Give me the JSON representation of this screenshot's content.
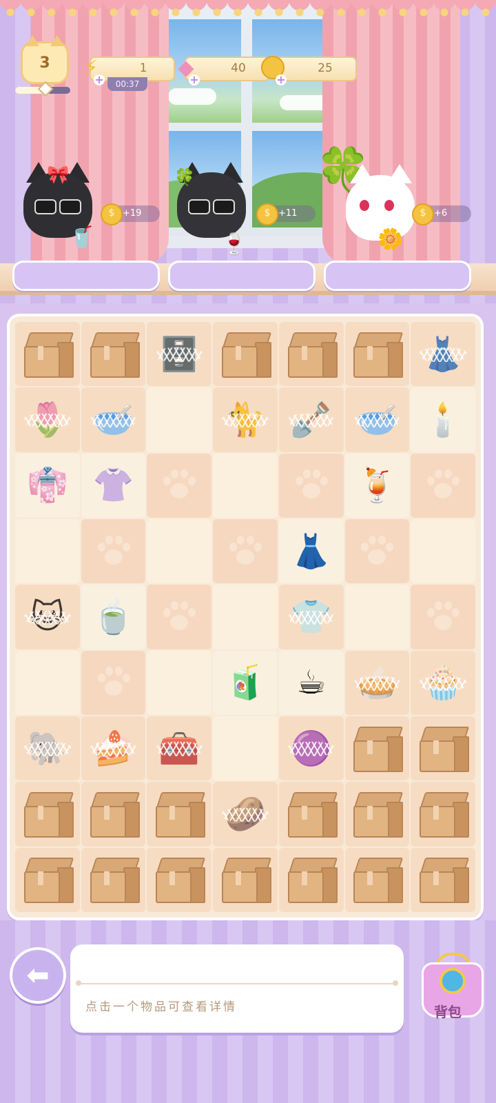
{
  "hud": {
    "level": "3",
    "level_progress": 0.55,
    "energy": {
      "value": "1",
      "icon": "lightning-icon",
      "timer": "00:37"
    },
    "gems": {
      "value": "40",
      "icon": "pink-gem-icon"
    },
    "coins": {
      "value": "25",
      "icon": "gold-coin-icon"
    }
  },
  "customers": [
    {
      "name": "black-cat-pink-bow",
      "reward": "+19",
      "order_icon": "parfait-icon"
    },
    {
      "name": "black-cat-clover",
      "reward": "+11",
      "order_icon": "wine-glass-icon"
    },
    {
      "name": "white-cat-clover-hat",
      "reward": "+6",
      "order_icon": "clover-flower-icon"
    }
  ],
  "board": {
    "columns": 7,
    "rows": [
      [
        {
          "t": "box"
        },
        {
          "t": "box"
        },
        {
          "t": "web",
          "i": "🗄️",
          "n": "display-cabinet"
        },
        {
          "t": "box"
        },
        {
          "t": "box"
        },
        {
          "t": "box"
        },
        {
          "t": "web",
          "i": "👗",
          "n": "clothes-rack"
        }
      ],
      [
        {
          "t": "web",
          "i": "🌷",
          "n": "tulip"
        },
        {
          "t": "web",
          "i": "🥣",
          "n": "pet-bowl"
        },
        {
          "t": "empty"
        },
        {
          "t": "web",
          "i": "🐈",
          "n": "grey-cat-statue"
        },
        {
          "t": "web",
          "i": "🪏",
          "n": "shovel"
        },
        {
          "t": "web",
          "i": "🥣",
          "n": "teal-bowl"
        },
        {
          "t": "item",
          "i": "🕯️",
          "n": "candelabra"
        }
      ],
      [
        {
          "t": "item",
          "i": "👘",
          "n": "yellow-dress"
        },
        {
          "t": "item",
          "i": "👚",
          "n": "blouse-skirt"
        },
        {
          "t": "paw"
        },
        {
          "t": "empty"
        },
        {
          "t": "paw"
        },
        {
          "t": "item",
          "i": "🍹",
          "n": "iced-tea"
        },
        {
          "t": "paw"
        }
      ],
      [
        {
          "t": "empty"
        },
        {
          "t": "paw"
        },
        {
          "t": "empty"
        },
        {
          "t": "paw"
        },
        {
          "t": "item",
          "i": "👗",
          "n": "white-dress"
        },
        {
          "t": "paw"
        },
        {
          "t": "empty"
        }
      ],
      [
        {
          "t": "web",
          "i": "🐱",
          "n": "cat-bed"
        },
        {
          "t": "item",
          "i": "🍵",
          "n": "tea-cup"
        },
        {
          "t": "paw"
        },
        {
          "t": "empty"
        },
        {
          "t": "web",
          "i": "👕",
          "n": "pink-rack"
        },
        {
          "t": "empty"
        },
        {
          "t": "paw"
        }
      ],
      [
        {
          "t": "empty"
        },
        {
          "t": "paw"
        },
        {
          "t": "empty"
        },
        {
          "t": "item",
          "i": "🧃",
          "n": "peach-drink"
        },
        {
          "t": "item",
          "i": "☕",
          "n": "coffee-maker"
        },
        {
          "t": "web",
          "i": "🥧",
          "n": "pie"
        },
        {
          "t": "web",
          "i": "🧁",
          "n": "cake"
        }
      ],
      [
        {
          "t": "web",
          "i": "🐘",
          "n": "elephant-plush"
        },
        {
          "t": "web",
          "i": "🍰",
          "n": "strawberry-cake"
        },
        {
          "t": "web",
          "i": "🧰",
          "n": "toaster"
        },
        {
          "t": "empty"
        },
        {
          "t": "web",
          "i": "🟣",
          "n": "purple-cushion"
        },
        {
          "t": "box"
        },
        {
          "t": "box"
        }
      ],
      [
        {
          "t": "box"
        },
        {
          "t": "box"
        },
        {
          "t": "box"
        },
        {
          "t": "web",
          "i": "🥔",
          "n": "bread-loaf"
        },
        {
          "t": "box"
        },
        {
          "t": "box"
        },
        {
          "t": "box"
        }
      ],
      [
        {
          "t": "box"
        },
        {
          "t": "box"
        },
        {
          "t": "box"
        },
        {
          "t": "box"
        },
        {
          "t": "box"
        },
        {
          "t": "box"
        },
        {
          "t": "box"
        }
      ]
    ]
  },
  "info_panel": {
    "hint": "点击一个物品可查看详情"
  },
  "bag_button": {
    "label": "背包"
  },
  "back_button": {
    "icon": "back-arrow-icon"
  }
}
